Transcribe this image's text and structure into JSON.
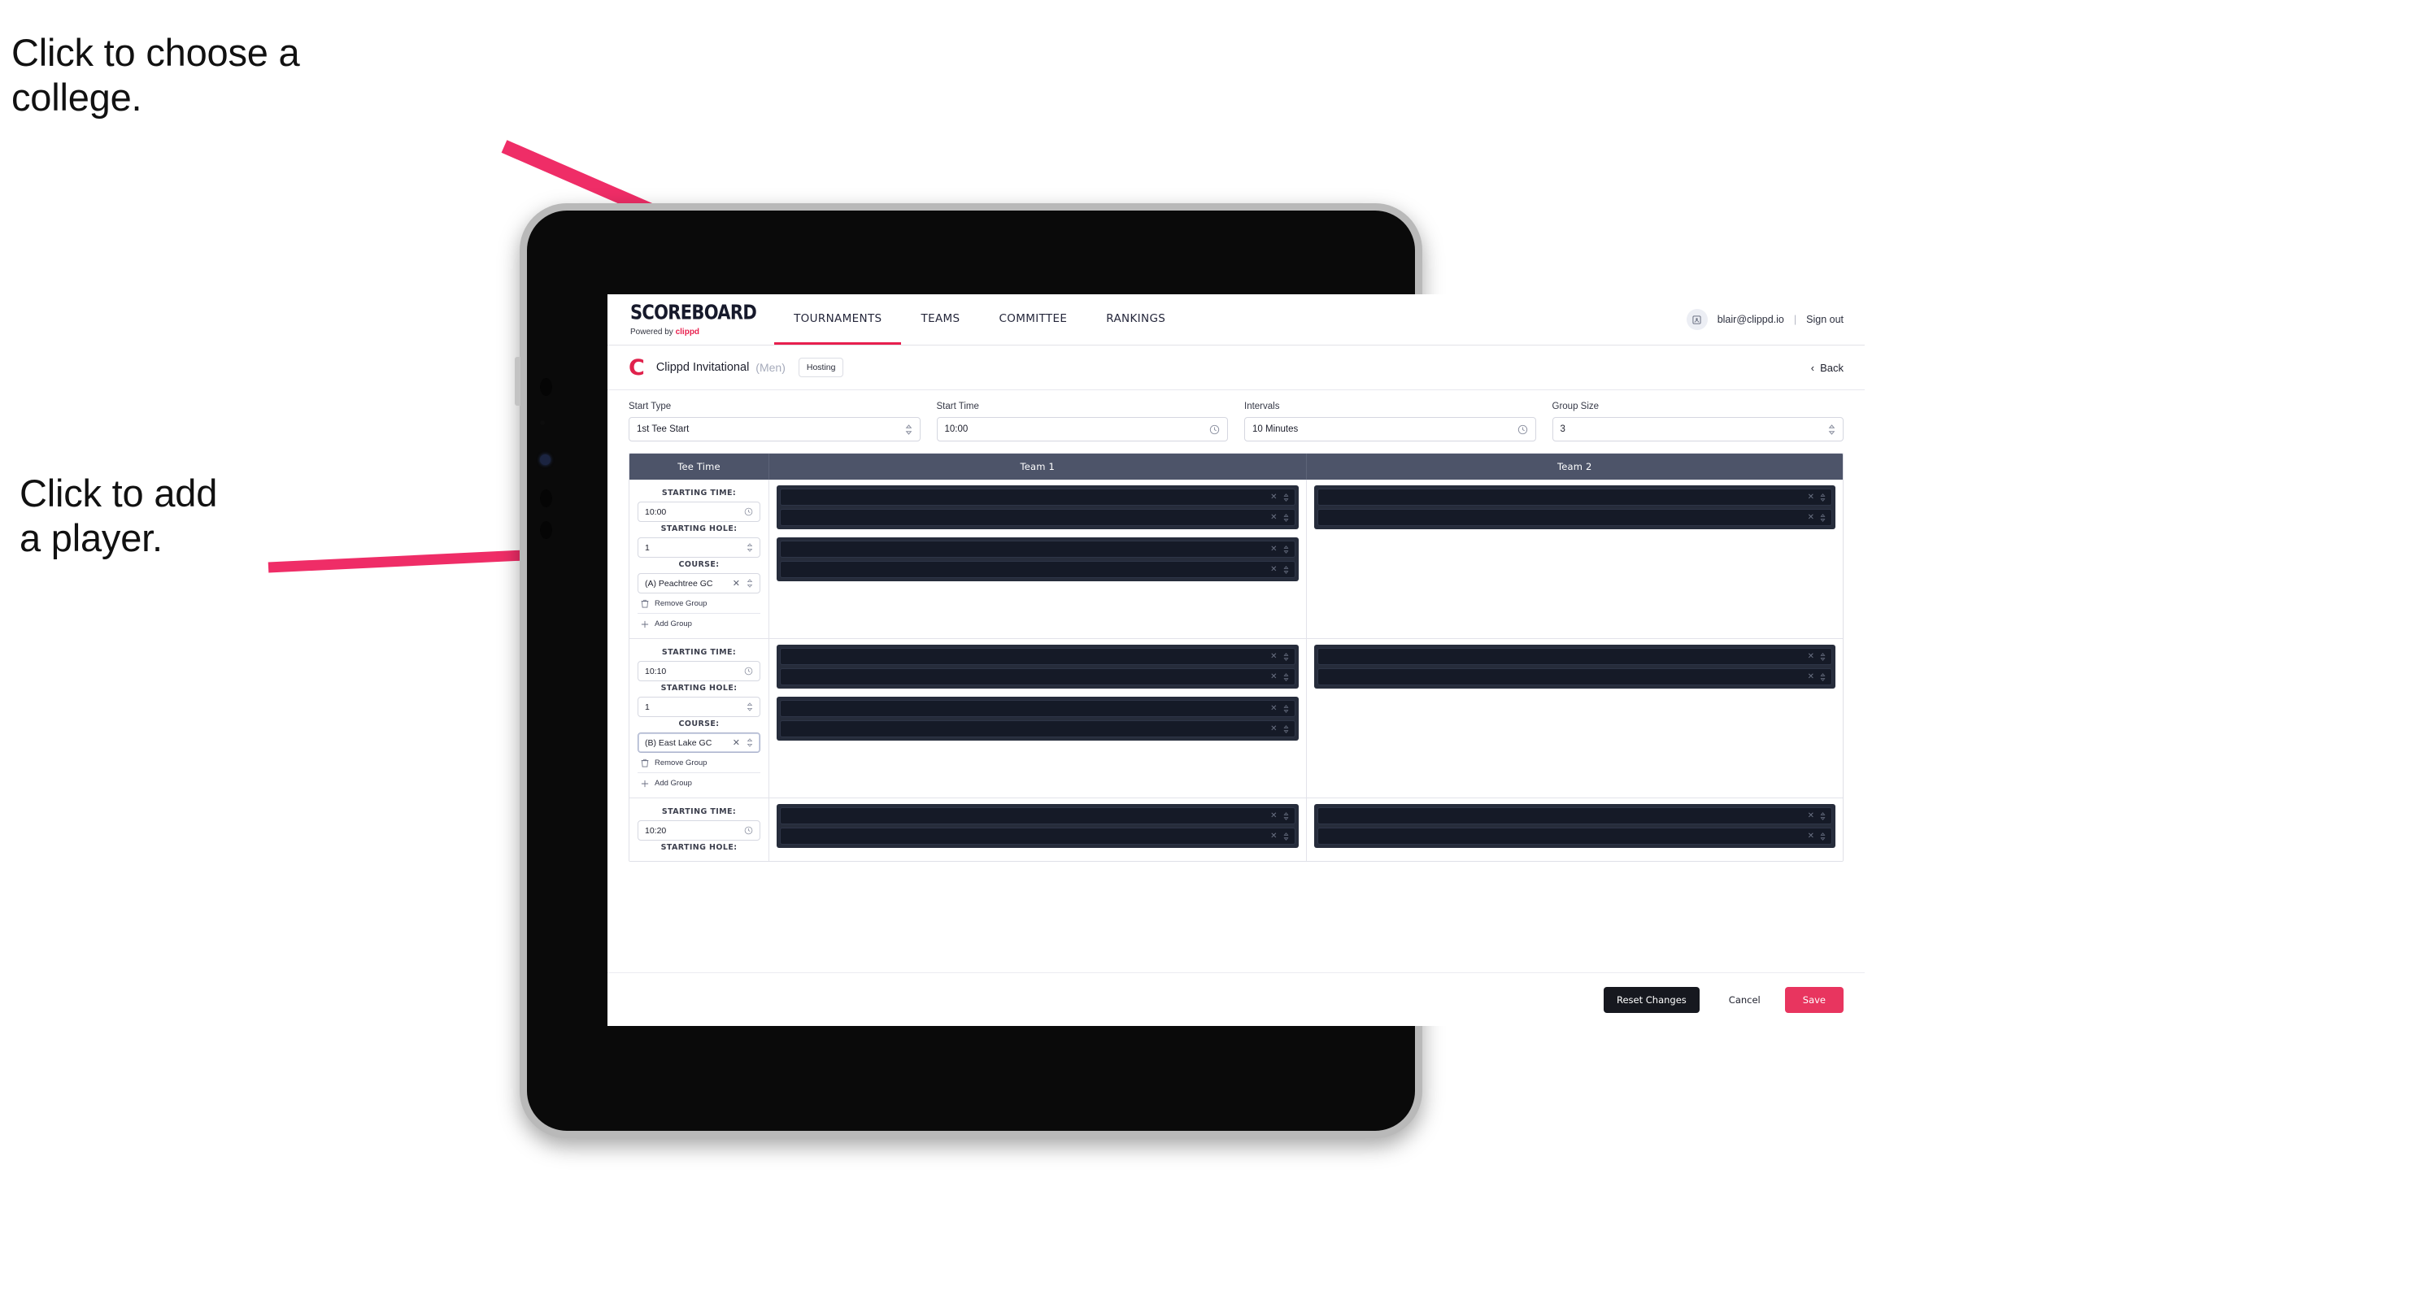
{
  "annotations": [
    {
      "id": "choose-college",
      "text": "Click to choose a\ncollege."
    },
    {
      "id": "add-player",
      "text": "Click to add\na player."
    }
  ],
  "colors": {
    "accent_pink": "#e8204e",
    "save_button": "#e8355f",
    "table_header": "#4d5469",
    "panel_dark": "#262c3b",
    "row_dark": "#151a27",
    "annotation_arrow": "#ef2d67"
  },
  "nav": {
    "brand_title": "SCOREBOARD",
    "brand_sub_prefix": "Powered by",
    "brand_sub_accent": "clippd",
    "items": [
      {
        "label": "TOURNAMENTS",
        "active": true
      },
      {
        "label": "TEAMS",
        "active": false
      },
      {
        "label": "COMMITTEE",
        "active": false
      },
      {
        "label": "RANKINGS",
        "active": false
      }
    ],
    "avatar_icon": "user-avatar-icon",
    "user_email": "blair@clippd.io",
    "separator": "|",
    "sign_out": "Sign out"
  },
  "subheader": {
    "logo_letter": "C",
    "tournament_name": "Clippd Invitational",
    "gender": "(Men)",
    "badge": "Hosting",
    "back_label": "Back"
  },
  "controls": [
    {
      "label": "Start Type",
      "value": "1st Tee Start",
      "icon": "stepper-icon"
    },
    {
      "label": "Start Time",
      "value": "10:00",
      "icon": "clock-icon"
    },
    {
      "label": "Intervals",
      "value": "10 Minutes",
      "icon": "clock-icon"
    },
    {
      "label": "Group Size",
      "value": "3",
      "icon": "stepper-icon"
    }
  ],
  "table": {
    "headers": {
      "tee_time": "Tee Time",
      "team1": "Team 1",
      "team2": "Team 2"
    },
    "field_labels": {
      "starting_time": "STARTING TIME:",
      "starting_hole": "STARTING HOLE:",
      "course": "COURSE:"
    },
    "actions": {
      "remove_group": "Remove Group",
      "add_group": "Add Group"
    },
    "groups": [
      {
        "starting_time": "10:00",
        "starting_hole": "1",
        "course": "(A) Peachtree GC",
        "course_focused": false,
        "team1_panels": [
          2,
          2
        ],
        "team2_panels": [
          2
        ]
      },
      {
        "starting_time": "10:10",
        "starting_hole": "1",
        "course": "(B) East Lake GC",
        "course_focused": true,
        "team1_panels": [
          2,
          2
        ],
        "team2_panels": [
          2
        ]
      },
      {
        "starting_time": "10:20",
        "starting_hole": "",
        "course": "",
        "course_focused": false,
        "team1_panels": [
          2
        ],
        "team2_panels": [
          2
        ]
      }
    ]
  },
  "footer": {
    "reset_label": "Reset Changes",
    "cancel_label": "Cancel",
    "save_label": "Save"
  }
}
